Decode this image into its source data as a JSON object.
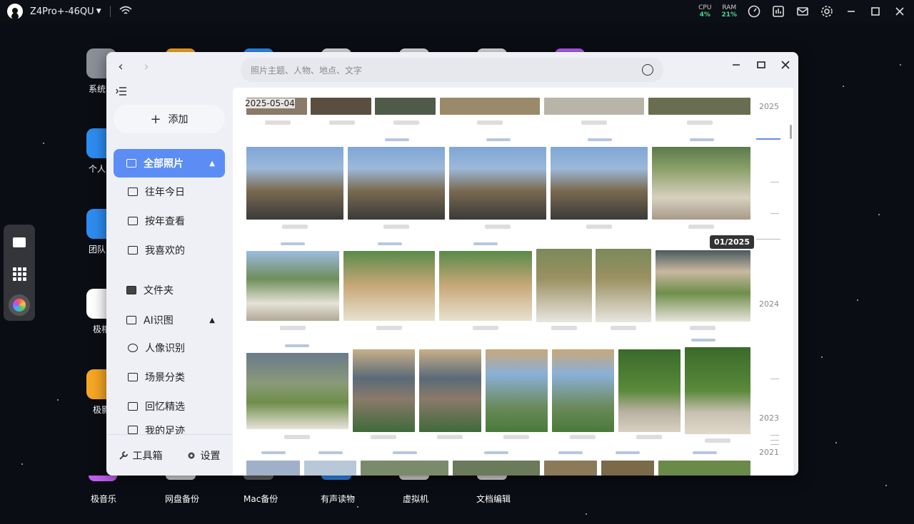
{
  "topbar": {
    "device_name": "Z4Pro+-46QU",
    "cpu_label": "CPU",
    "cpu_value": "4%",
    "ram_label": "RAM",
    "ram_value": "21%"
  },
  "desktop": {
    "apps": [
      "系统设",
      "个人空",
      "团队空",
      "极相",
      "极影"
    ],
    "bottom_apps": [
      "极音乐",
      "网盘备份",
      "Mac备份",
      "有声读物",
      "虚拟机",
      "文档编辑"
    ]
  },
  "window": {
    "search_placeholder": "照片主题、人物、地点、文字"
  },
  "sidebar": {
    "add_label": "添加",
    "all_photos": "全部照片",
    "items": [
      "往年今日",
      "按年查看",
      "我喜欢的"
    ],
    "folders": "文件夹",
    "ai_section": "AI识图",
    "ai_items": [
      "人像识别",
      "场景分类",
      "回忆精选",
      "我的足迹"
    ],
    "toolbox": "工具箱",
    "settings": "设置"
  },
  "content": {
    "date_label": "2025-05-04",
    "timeline_tooltip": "01/2025",
    "timeline_years": [
      "2025",
      "2024",
      "2023",
      "2021"
    ]
  },
  "colors": {
    "accent": "#5b8df5",
    "topbar_green": "#3ddc97"
  }
}
